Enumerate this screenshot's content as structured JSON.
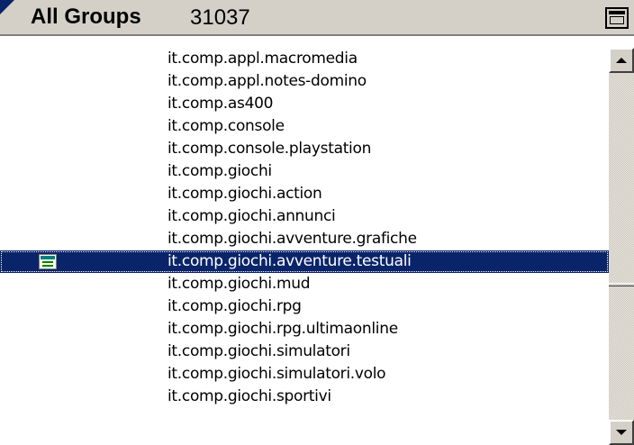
{
  "header": {
    "title": "All Groups",
    "count": "31037"
  },
  "list": {
    "selected_index": 9,
    "items": [
      {
        "label": "it.comp.appl.macromedia"
      },
      {
        "label": "it.comp.appl.notes-domino"
      },
      {
        "label": "it.comp.as400"
      },
      {
        "label": "it.comp.console"
      },
      {
        "label": "it.comp.console.playstation"
      },
      {
        "label": "it.comp.giochi"
      },
      {
        "label": "it.comp.giochi.action"
      },
      {
        "label": "it.comp.giochi.annunci"
      },
      {
        "label": "it.comp.giochi.avventure.grafiche"
      },
      {
        "label": "it.comp.giochi.avventure.testuali",
        "icon": "newsgroup-subscribed-icon"
      },
      {
        "label": "it.comp.giochi.mud"
      },
      {
        "label": "it.comp.giochi.rpg"
      },
      {
        "label": "it.comp.giochi.rpg.ultimaonline"
      },
      {
        "label": "it.comp.giochi.simulatori"
      },
      {
        "label": "it.comp.giochi.simulatori.volo"
      },
      {
        "label": "it.comp.giochi.sportivi"
      }
    ]
  },
  "icons": {
    "header_corner": "corner-triangle-icon",
    "maximize": "maximize-icon",
    "scroll_up": "arrow-up-icon",
    "scroll_down": "arrow-down-icon"
  },
  "colors": {
    "selection_bg": "#0a246a",
    "selection_text": "#ffffff",
    "header_bg": "#d4d0c8"
  }
}
